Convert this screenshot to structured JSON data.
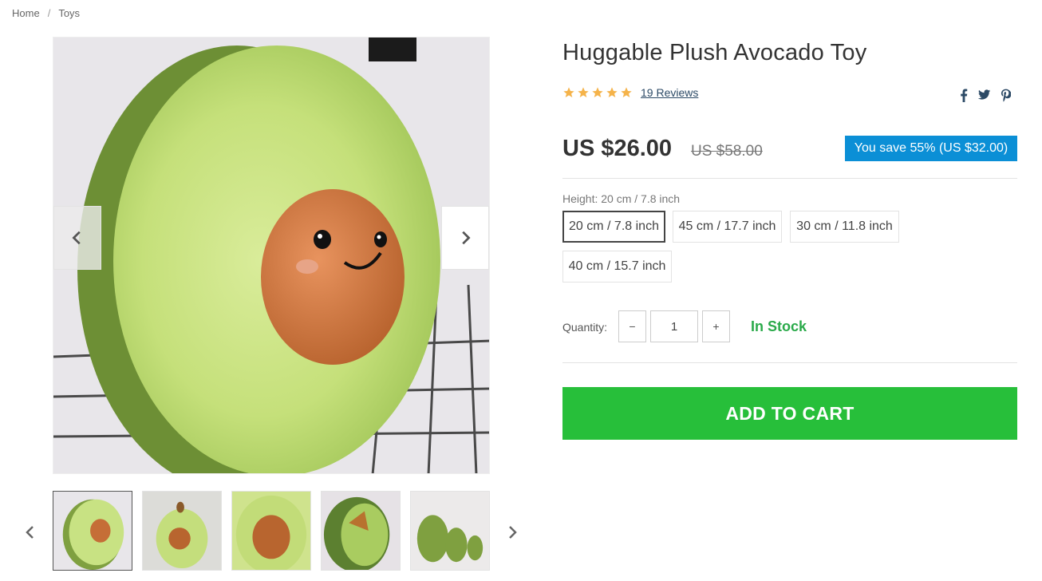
{
  "breadcrumb": {
    "home": "Home",
    "separator": "/",
    "current": "Toys"
  },
  "product": {
    "title": "Huggable Plush Avocado Toy",
    "rating_stars": 5,
    "reviews": "19 Reviews",
    "price": "US $26.00",
    "old_price": "US $58.00",
    "save_text": "You save 55% (US $32.00)",
    "variant_label": "Height:",
    "variant_selected": "20 cm / 7.8 inch",
    "variants": [
      "20 cm / 7.8 inch",
      "45 cm / 17.7 inch",
      "30 cm / 11.8 inch",
      "40 cm / 15.7 inch"
    ],
    "quantity_label": "Quantity:",
    "qty_minus": "−",
    "qty_plus": "+",
    "quantity": "1",
    "stock": "In Stock",
    "add_to_cart": "ADD TO CART"
  },
  "share_icons": [
    "facebook-icon",
    "twitter-icon",
    "pinterest-icon"
  ],
  "gallery": {
    "thumbnail_count": 5,
    "active_index": 0
  },
  "colors": {
    "accent_green": "#27bf3a",
    "stock_green": "#2aaa4a",
    "badge_blue": "#0b8fd6",
    "star": "#f5b34a"
  }
}
